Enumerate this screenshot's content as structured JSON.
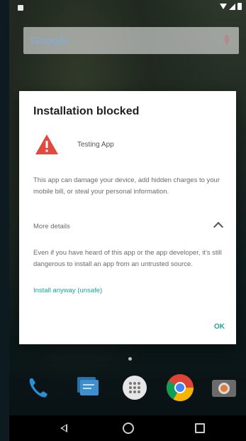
{
  "colors": {
    "accent": "#1aa39a",
    "warning": "#e04a3f",
    "dialog_bg": "#ffffff"
  },
  "status_bar": {
    "icons": [
      "notification-icon",
      "wifi-icon",
      "signal-icon",
      "battery-icon"
    ]
  },
  "search": {
    "logo": "Google",
    "icon": "mic-icon"
  },
  "dialog": {
    "title": "Installation blocked",
    "app_name": "Testing App",
    "warning_text": "This app can damage your device, add hidden charges to your mobile bill, or steal your personal information.",
    "more_details_label": "More details",
    "detail_text": "Even if you have heard of this app or the app developer, it's still dangerous to install an app from an untrusted source.",
    "install_anyway_label": "Install anyway (unsafe)",
    "ok_label": "OK"
  },
  "dock": {
    "icons": [
      "phone-icon",
      "messages-icon",
      "apps-icon",
      "chrome-icon",
      "camera-icon"
    ]
  },
  "nav": {
    "icons": [
      "back-icon",
      "home-icon",
      "recent-apps-icon"
    ]
  }
}
